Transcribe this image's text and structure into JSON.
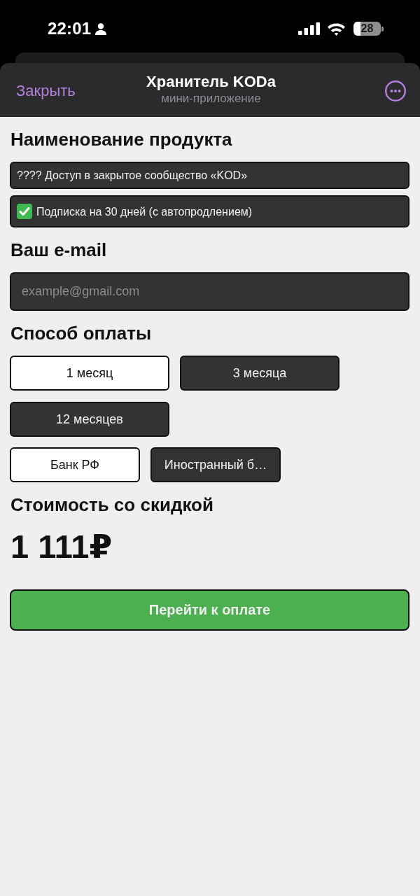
{
  "status_bar": {
    "time": "22:01",
    "battery": "28"
  },
  "header": {
    "close": "Закрыть",
    "title": "Хранитель KODa",
    "subtitle": "мини-приложение"
  },
  "product": {
    "heading": "Наименование продукта",
    "items": [
      {
        "kind": "plain",
        "text": "???? Доступ в закрытое сообщество «KOD»"
      },
      {
        "kind": "check",
        "text": "Подписка на 30 дней (с автопродлением)"
      }
    ]
  },
  "email": {
    "heading": "Ваш e-mail",
    "placeholder": "example@gmail.com"
  },
  "payment": {
    "heading": "Способ оплаты",
    "periods": [
      {
        "label": "1 месяц",
        "selected": true
      },
      {
        "label": "3 месяца",
        "selected": false
      },
      {
        "label": "12 месяцев",
        "selected": false
      }
    ],
    "banks": [
      {
        "label": "Банк РФ",
        "selected": true
      },
      {
        "label": "Иностранный б…",
        "selected": false
      }
    ]
  },
  "price": {
    "heading": "Стоимость со скидкой",
    "amount": "1 111₽"
  },
  "submit": {
    "label": "Перейти к оплате"
  }
}
